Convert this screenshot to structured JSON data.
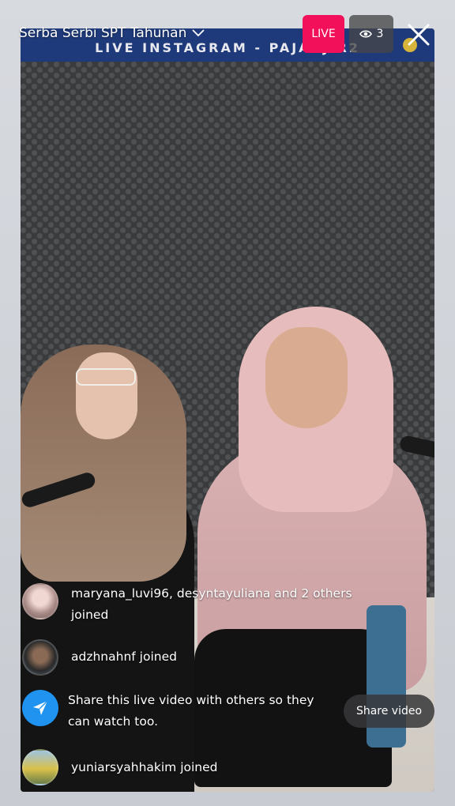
{
  "header": {
    "title": "Serba Serbi SPT Tahunan",
    "live_label": "LIVE",
    "viewer_count": "3"
  },
  "video": {
    "banner_text": "LIVE INSTAGRAM - PAJAKJ    R2"
  },
  "feed": {
    "items": [
      {
        "text_line1": "maryana_luvi96, desyntayuliana and 2 others",
        "text_line2": "joined"
      },
      {
        "text_line1": "adzhnahnf joined"
      },
      {
        "text_line1": "Share this live video with others so they",
        "text_line2": "can watch too."
      },
      {
        "text_line1": "yuniarsyahhakim joined"
      }
    ],
    "share_button_label": "Share video"
  },
  "colors": {
    "live_red": "#f2105a",
    "share_blue": "#1f93ef",
    "banner_navy": "#1f3a7a"
  },
  "icons": {
    "dropdown": "chevron-down-icon",
    "viewers": "eye-icon",
    "close": "close-icon",
    "share": "paper-plane-icon"
  }
}
